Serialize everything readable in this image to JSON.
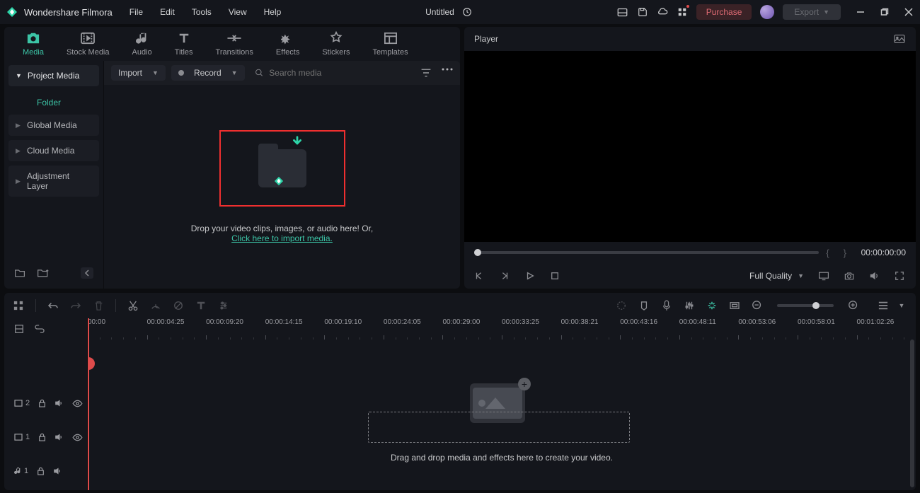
{
  "app": {
    "name": "Wondershare Filmora",
    "title": "Untitled"
  },
  "menus": [
    "File",
    "Edit",
    "Tools",
    "View",
    "Help"
  ],
  "titlebar": {
    "purchase": "Purchase",
    "export": "Export"
  },
  "tabs": [
    {
      "id": "media",
      "label": "Media"
    },
    {
      "id": "stock",
      "label": "Stock Media"
    },
    {
      "id": "audio",
      "label": "Audio"
    },
    {
      "id": "titles",
      "label": "Titles"
    },
    {
      "id": "trans",
      "label": "Transitions"
    },
    {
      "id": "effects",
      "label": "Effects"
    },
    {
      "id": "stickers",
      "label": "Stickers"
    },
    {
      "id": "templates",
      "label": "Templates"
    }
  ],
  "sidebar": {
    "project": "Project Media",
    "folder": "Folder",
    "items": [
      "Global Media",
      "Cloud Media",
      "Adjustment Layer"
    ]
  },
  "media_toolbar": {
    "import": "Import",
    "record": "Record",
    "search_placeholder": "Search media"
  },
  "drop": {
    "line1": "Drop your video clips, images, or audio here! Or,",
    "link": "Click here to import media."
  },
  "player": {
    "title": "Player",
    "timecode": "00:00:00:00",
    "quality": "Full Quality"
  },
  "ruler": [
    "00:00",
    "00:00:04:25",
    "00:00:09:20",
    "00:00:14:15",
    "00:00:19:10",
    "00:00:24:05",
    "00:00:29:00",
    "00:00:33:25",
    "00:00:38:21",
    "00:00:43:16",
    "00:00:48:11",
    "00:00:53:06",
    "00:00:58:01",
    "00:01:02:26"
  ],
  "tracks": {
    "v2": "2",
    "v1": "1",
    "a1": "1"
  },
  "timeline_hint": "Drag and drop media and effects here to create your video."
}
